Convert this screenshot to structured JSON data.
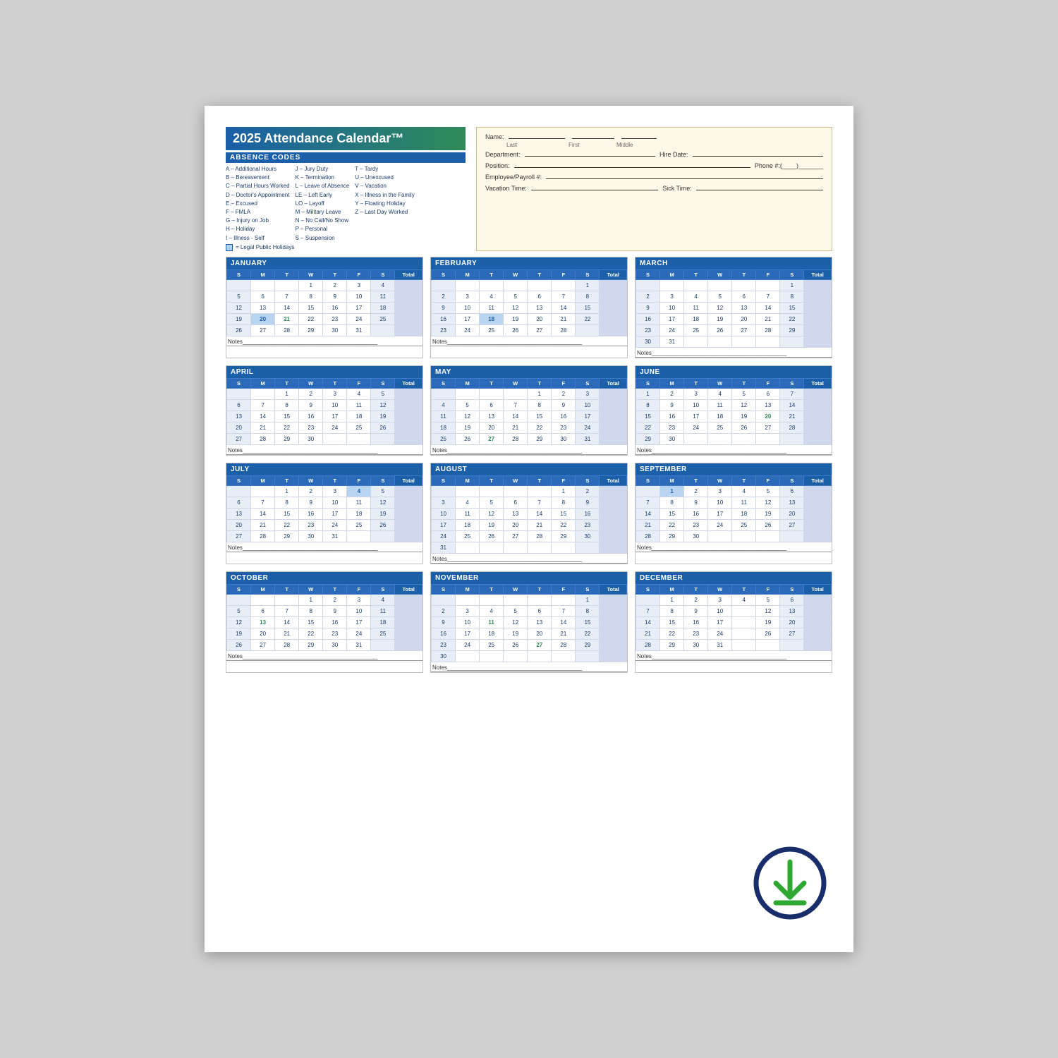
{
  "title": "2025 Attendance Calendar™",
  "absence_codes_header": "ABSENCE CODES",
  "codes_col1": [
    "A – Additional Hours",
    "B – Bereavement",
    "C – Partial Hours Worked",
    "D – Doctor's Appointment",
    "E – Excused",
    "F – FMLA",
    "G – Injury on Job",
    "H – Holiday",
    "I – Illness - Self"
  ],
  "codes_col2": [
    "J – Jury Duty",
    "K – Termination",
    "L – Leave of Absence",
    "LE – Left Early",
    "LO – Layoff",
    "M – Military Leave",
    "N – No Call/No Show",
    "P – Personal",
    "S – Suspension"
  ],
  "codes_col3": [
    "T – Tardy",
    "U – Unexcused",
    "V – Vacation",
    "X – Illness in the Family",
    "Y – Floating Holiday",
    "Z – Last Day Worked"
  ],
  "holiday_note": "= Legal Public Holidays",
  "employee_fields": {
    "name_label": "Name:",
    "last_label": "Last",
    "first_label": "First",
    "middle_label": "Middle",
    "dept_label": "Department:",
    "hire_label": "Hire Date:",
    "hire_placeholder": "___/___/___",
    "pos_label": "Position:",
    "phone_label": "Phone #:(____)_______",
    "payroll_label": "Employee/Payroll #:",
    "vacation_label": "Vacation Time:",
    "sick_label": "Sick Time:"
  },
  "months": [
    {
      "name": "JANUARY",
      "days_header": [
        "S",
        "M",
        "T",
        "W",
        "T",
        "F",
        "S",
        "Total"
      ],
      "weeks": [
        [
          "",
          "",
          "",
          "1",
          "2",
          "3",
          "4",
          ""
        ],
        [
          "5",
          "6",
          "7",
          "8",
          "9",
          "10",
          "11",
          ""
        ],
        [
          "12",
          "13",
          "14",
          "15",
          "16",
          "17",
          "18",
          ""
        ],
        [
          "19",
          "20",
          "21",
          "22",
          "23",
          "24",
          "25",
          ""
        ],
        [
          "26",
          "27",
          "28",
          "29",
          "30",
          "31",
          "",
          ""
        ]
      ],
      "highlights": {
        "3_1": "holiday",
        "3_2": "green"
      }
    },
    {
      "name": "FEBRUARY",
      "days_header": [
        "S",
        "M",
        "T",
        "W",
        "T",
        "F",
        "S",
        "Total"
      ],
      "weeks": [
        [
          "",
          "",
          "",
          "",
          "",
          "",
          "1",
          ""
        ],
        [
          "2",
          "3",
          "4",
          "5",
          "6",
          "7",
          "8",
          ""
        ],
        [
          "9",
          "10",
          "11",
          "12",
          "13",
          "14",
          "15",
          ""
        ],
        [
          "16",
          "17",
          "18",
          "19",
          "20",
          "21",
          "22",
          ""
        ],
        [
          "23",
          "24",
          "25",
          "26",
          "27",
          "28",
          "",
          ""
        ]
      ],
      "highlights": {
        "3_2": "holiday"
      }
    },
    {
      "name": "MARCH",
      "days_header": [
        "S",
        "M",
        "T",
        "W",
        "T",
        "F",
        "S",
        "Total"
      ],
      "weeks": [
        [
          "",
          "",
          "",
          "",
          "",
          "",
          "1",
          ""
        ],
        [
          "2",
          "3",
          "4",
          "5",
          "6",
          "7",
          "8",
          ""
        ],
        [
          "9",
          "10",
          "11",
          "12",
          "13",
          "14",
          "15",
          ""
        ],
        [
          "16",
          "17",
          "18",
          "19",
          "20",
          "21",
          "22",
          ""
        ],
        [
          "23",
          "24",
          "25",
          "26",
          "27",
          "28",
          "29",
          ""
        ],
        [
          "30",
          "31",
          "",
          "",
          "",
          "",
          "",
          ""
        ]
      ]
    },
    {
      "name": "APRIL",
      "days_header": [
        "S",
        "M",
        "T",
        "W",
        "T",
        "F",
        "S",
        "Total"
      ],
      "weeks": [
        [
          "",
          "",
          "1",
          "2",
          "3",
          "4",
          "5",
          ""
        ],
        [
          "6",
          "7",
          "8",
          "9",
          "10",
          "11",
          "12",
          ""
        ],
        [
          "13",
          "14",
          "15",
          "16",
          "17",
          "18",
          "19",
          ""
        ],
        [
          "20",
          "21",
          "22",
          "23",
          "24",
          "25",
          "26",
          ""
        ],
        [
          "27",
          "28",
          "29",
          "30",
          "",
          "",
          "",
          ""
        ]
      ]
    },
    {
      "name": "MAY",
      "days_header": [
        "S",
        "M",
        "T",
        "W",
        "T",
        "F",
        "S",
        "Total"
      ],
      "weeks": [
        [
          "",
          "",
          "",
          "",
          "1",
          "2",
          "3",
          ""
        ],
        [
          "4",
          "5",
          "6",
          "7",
          "8",
          "9",
          "10",
          ""
        ],
        [
          "11",
          "12",
          "13",
          "14",
          "15",
          "16",
          "17",
          ""
        ],
        [
          "18",
          "19",
          "20",
          "21",
          "22",
          "23",
          "24",
          ""
        ],
        [
          "25",
          "26",
          "27",
          "28",
          "29",
          "30",
          "31",
          ""
        ]
      ],
      "highlights": {
        "4_2": "green"
      }
    },
    {
      "name": "JUNE",
      "days_header": [
        "S",
        "M",
        "T",
        "W",
        "T",
        "F",
        "S",
        "Total"
      ],
      "weeks": [
        [
          "1",
          "2",
          "3",
          "4",
          "5",
          "6",
          "7",
          ""
        ],
        [
          "8",
          "9",
          "10",
          "11",
          "12",
          "13",
          "14",
          ""
        ],
        [
          "15",
          "16",
          "17",
          "18",
          "19",
          "20",
          "21",
          ""
        ],
        [
          "22",
          "23",
          "24",
          "25",
          "26",
          "27",
          "28",
          ""
        ],
        [
          "29",
          "30",
          "",
          "",
          "",
          "",
          "",
          ""
        ]
      ],
      "highlights": {
        "2_5": "green"
      }
    },
    {
      "name": "JULY",
      "days_header": [
        "S",
        "M",
        "T",
        "W",
        "T",
        "F",
        "S",
        "Total"
      ],
      "weeks": [
        [
          "",
          "",
          "1",
          "2",
          "3",
          "4",
          "5",
          ""
        ],
        [
          "6",
          "7",
          "8",
          "9",
          "10",
          "11",
          "12",
          ""
        ],
        [
          "13",
          "14",
          "15",
          "16",
          "17",
          "18",
          "19",
          ""
        ],
        [
          "20",
          "21",
          "22",
          "23",
          "24",
          "25",
          "26",
          ""
        ],
        [
          "27",
          "28",
          "29",
          "30",
          "31",
          "",
          "",
          ""
        ]
      ],
      "highlights": {
        "0_5": "holiday"
      }
    },
    {
      "name": "AUGUST",
      "days_header": [
        "S",
        "M",
        "T",
        "W",
        "T",
        "F",
        "S",
        "Total"
      ],
      "weeks": [
        [
          "",
          "",
          "",
          "",
          "",
          "1",
          "2",
          ""
        ],
        [
          "3",
          "4",
          "5",
          "6",
          "7",
          "8",
          "9",
          ""
        ],
        [
          "10",
          "11",
          "12",
          "13",
          "14",
          "15",
          "16",
          ""
        ],
        [
          "17",
          "18",
          "19",
          "20",
          "21",
          "22",
          "23",
          ""
        ],
        [
          "24",
          "25",
          "26",
          "27",
          "28",
          "29",
          "30",
          ""
        ],
        [
          "31",
          "",
          "",
          "",
          "",
          "",
          "",
          ""
        ]
      ]
    },
    {
      "name": "SEPTEMBER",
      "days_header": [
        "S",
        "M",
        "T",
        "W",
        "T",
        "F",
        "S",
        "Total"
      ],
      "weeks": [
        [
          "",
          "1",
          "2",
          "3",
          "4",
          "5",
          "6",
          ""
        ],
        [
          "7",
          "8",
          "9",
          "10",
          "11",
          "12",
          "13",
          ""
        ],
        [
          "14",
          "15",
          "16",
          "17",
          "18",
          "19",
          "20",
          ""
        ],
        [
          "21",
          "22",
          "23",
          "24",
          "25",
          "26",
          "27",
          ""
        ],
        [
          "28",
          "29",
          "30",
          "",
          "",
          "",
          "",
          ""
        ]
      ],
      "highlights": {
        "0_1": "holiday"
      }
    },
    {
      "name": "OCTOBER",
      "days_header": [
        "S",
        "M",
        "T",
        "W",
        "T",
        "F",
        "S",
        "Total"
      ],
      "weeks": [
        [
          "",
          "",
          "",
          "1",
          "2",
          "3",
          "4",
          ""
        ],
        [
          "5",
          "6",
          "7",
          "8",
          "9",
          "10",
          "11",
          ""
        ],
        [
          "12",
          "13",
          "14",
          "15",
          "16",
          "17",
          "18",
          ""
        ],
        [
          "19",
          "20",
          "21",
          "22",
          "23",
          "24",
          "25",
          ""
        ],
        [
          "26",
          "27",
          "28",
          "29",
          "30",
          "31",
          "",
          ""
        ]
      ],
      "highlights": {
        "2_1": "green"
      }
    },
    {
      "name": "NOVEMBER",
      "days_header": [
        "S",
        "M",
        "T",
        "W",
        "T",
        "F",
        "S",
        "Total"
      ],
      "weeks": [
        [
          "",
          "",
          "",
          "",
          "",
          "",
          "1",
          ""
        ],
        [
          "2",
          "3",
          "4",
          "5",
          "6",
          "7",
          "8",
          ""
        ],
        [
          "9",
          "10",
          "11",
          "12",
          "13",
          "14",
          "15",
          ""
        ],
        [
          "16",
          "17",
          "18",
          "19",
          "20",
          "21",
          "22",
          ""
        ],
        [
          "23",
          "24",
          "25",
          "26",
          "27",
          "28",
          "29",
          ""
        ],
        [
          "30",
          "",
          "",
          "",
          "",
          "",
          "",
          ""
        ]
      ],
      "highlights": {
        "2_2": "green",
        "4_4": "green"
      }
    },
    {
      "name": "DECEMBER",
      "days_header": [
        "S",
        "M",
        "T",
        "W",
        "T",
        "F",
        "S",
        "Total"
      ],
      "weeks": [
        [
          "",
          "1",
          "2",
          "3",
          "4",
          "5",
          "6",
          ""
        ],
        [
          "7",
          "8",
          "9",
          "10",
          "",
          "12",
          "13",
          ""
        ],
        [
          "14",
          "15",
          "16",
          "17",
          "",
          "19",
          "20",
          ""
        ],
        [
          "21",
          "22",
          "23",
          "24",
          "",
          "26",
          "27",
          ""
        ],
        [
          "28",
          "29",
          "30",
          "31",
          "",
          "",
          "",
          ""
        ]
      ]
    }
  ],
  "notes_label": "Notes"
}
